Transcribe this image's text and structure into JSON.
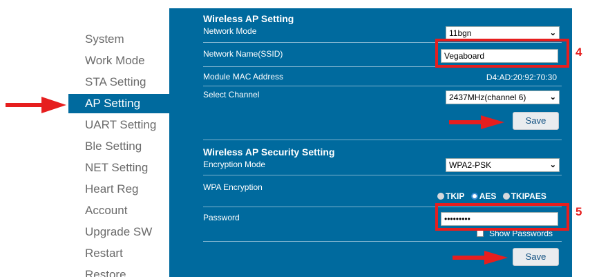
{
  "sidebar": {
    "items": [
      {
        "label": "System"
      },
      {
        "label": "Work Mode"
      },
      {
        "label": "STA Setting"
      },
      {
        "label": "AP Setting"
      },
      {
        "label": "UART Setting"
      },
      {
        "label": "Ble Setting"
      },
      {
        "label": "NET Setting"
      },
      {
        "label": "Heart Reg"
      },
      {
        "label": "Account"
      },
      {
        "label": "Upgrade SW"
      },
      {
        "label": "Restart"
      },
      {
        "label": "Restore"
      }
    ],
    "active_index": 3
  },
  "ap_setting": {
    "title": "Wireless AP Setting",
    "network_mode_label": "Network Mode",
    "network_mode_value": "11bgn",
    "ssid_label": "Network Name(SSID)",
    "ssid_value": "Vegaboard",
    "mac_label": "Module MAC Address",
    "mac_value": "D4:AD:20:92:70:30",
    "channel_label": "Select Channel",
    "channel_value": "2437MHz(channel 6)",
    "save_label": "Save"
  },
  "ap_security": {
    "title": "Wireless AP Security Setting",
    "encryption_mode_label": "Encryption Mode",
    "encryption_mode_value": "WPA2-PSK",
    "wpa_label": "WPA Encryption",
    "wpa_options": [
      "TKIP",
      "AES",
      "TKIPAES"
    ],
    "wpa_selected": "AES",
    "password_label": "Password",
    "password_value": "•••••••••",
    "show_passwords_label": "Show Passwords",
    "save_label": "Save"
  },
  "annotations": {
    "step_4": "4",
    "step_5": "5"
  },
  "colors": {
    "panel": "#006a9e",
    "annotation_red": "#e61e1e"
  }
}
